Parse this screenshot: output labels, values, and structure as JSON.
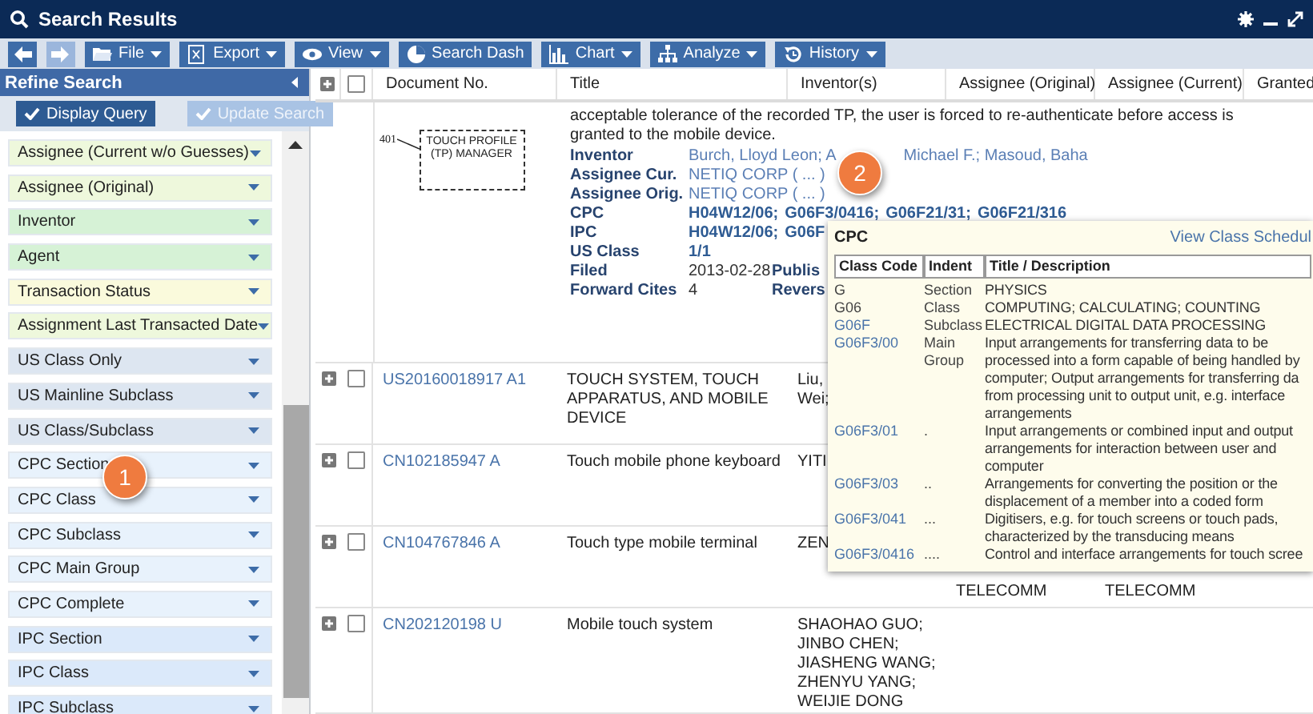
{
  "window": {
    "title": "Search Results"
  },
  "toolbar": [
    {
      "kind": "nav",
      "disabled": false
    },
    {
      "kind": "nav",
      "disabled": true
    },
    {
      "kind": "button",
      "label": "File",
      "menu": true
    },
    {
      "kind": "button",
      "label": "Export",
      "menu": true
    },
    {
      "kind": "button",
      "label": "View",
      "menu": true
    },
    {
      "kind": "button",
      "label": "Search Dash",
      "menu": false
    },
    {
      "kind": "button",
      "label": "Chart",
      "menu": true
    },
    {
      "kind": "button",
      "label": "Analyze",
      "menu": true
    },
    {
      "kind": "button",
      "label": "History",
      "menu": true
    }
  ],
  "refine": {
    "title": "Refine Search",
    "actions": [
      {
        "label": "Display Query",
        "disabled": false
      },
      {
        "label": "Update Search",
        "disabled": true
      }
    ],
    "filters": [
      {
        "label": "Assignee (Current w/o Guesses)",
        "color": "#eef8dc"
      },
      {
        "label": "Assignee (Original)",
        "color": "#eef8dc"
      },
      {
        "label": "Inventor",
        "color": "#d6f2d6"
      },
      {
        "label": "Agent",
        "color": "#d6f2d6"
      },
      {
        "label": "Transaction Status",
        "color": "#fafadc"
      },
      {
        "label": "Assignment Last Transacted Date",
        "color": "#eef8dc"
      },
      {
        "label": "US Class Only",
        "color": "#dde6f1"
      },
      {
        "label": "US Mainline Subclass",
        "color": "#dde6f1"
      },
      {
        "label": "US Class/Subclass",
        "color": "#dde6f1"
      },
      {
        "label": "CPC Section",
        "color": "#e8f2fc"
      },
      {
        "label": "CPC Class",
        "color": "#e8f2fc"
      },
      {
        "label": "CPC Subclass",
        "color": "#e8f2fc"
      },
      {
        "label": "CPC Main Group",
        "color": "#e8f2fc"
      },
      {
        "label": "CPC Complete",
        "color": "#e8f2fc"
      },
      {
        "label": "IPC Section",
        "color": "#dbe9fa"
      },
      {
        "label": "IPC Class",
        "color": "#dbe9fa"
      },
      {
        "label": "IPC Subclass",
        "color": "#dbe9fa"
      }
    ]
  },
  "table": {
    "select_all": {
      "checked": false
    },
    "columns": [
      "Document No.",
      "Title",
      "Inventor(s)",
      "Assignee (Original)",
      "Assignee (Current)",
      "Granted"
    ],
    "detail": {
      "figure": {
        "ref": "401",
        "box": "TOUCH PROFILE (TP) MANAGER"
      },
      "abstract_lines": [
        "acceptable tolerance of the recorded TP, the user is forced to re-authenticate before access is",
        "granted to the mobile device."
      ],
      "fields": [
        {
          "label": "Inventor",
          "kind": "link",
          "values": [
            "Burch, Lloyd Leon; A",
            "Michael F.; Masoud, Baha"
          ]
        },
        {
          "label": "Assignee Cur.",
          "kind": "link",
          "values": [
            "NETIQ CORP ( ... )"
          ]
        },
        {
          "label": "Assignee Orig.",
          "kind": "link",
          "values": [
            "NETIQ CORP ( ... )"
          ]
        },
        {
          "label": "CPC",
          "kind": "code",
          "values": [
            "H04W12/06;",
            "G06F3/0416;",
            "G06F21/31;",
            "G06F21/316"
          ]
        },
        {
          "label": "IPC",
          "kind": "code",
          "values": [
            "H04W12/06;",
            "G06F"
          ]
        },
        {
          "label": "US Class",
          "kind": "code",
          "values": [
            "1/1"
          ]
        },
        {
          "label": "Filed",
          "kind": "text",
          "values": [
            "2013-02-28"
          ],
          "side_label": "Publis"
        },
        {
          "label": "Forward Cites",
          "kind": "text",
          "values": [
            "4"
          ],
          "side_label": "Revers"
        }
      ]
    },
    "rows": [
      {
        "checked": false,
        "doc": "US20160018917 A1",
        "title": "TOUCH SYSTEM, TOUCH APPARATUS, AND MOBILE DEVICE",
        "inventors": [
          "Liu,",
          "Wei;"
        ]
      },
      {
        "checked": false,
        "doc": "CN102185947 A",
        "title": "Touch mobile phone keyboard",
        "inventors": [
          "YITI"
        ]
      },
      {
        "checked": false,
        "doc": "CN104767846 A",
        "title": "Touch type mobile terminal",
        "inventors": [
          "ZEN"
        ],
        "assignee_original": "TELECOMM",
        "assignee_current": "TELECOMM"
      },
      {
        "checked": false,
        "doc": "CN202120198 U",
        "title": "Mobile touch system",
        "inventors": [
          "SHAOHAO GUO;",
          "JINBO CHEN;",
          "JIASHENG WANG;",
          "ZHENYU YANG;",
          "WEIJIE DONG"
        ]
      }
    ]
  },
  "popup": {
    "title": "CPC",
    "link": "View Class Schedul",
    "columns": [
      "Class Code",
      "Indent",
      "Title / Description"
    ],
    "rows": [
      {
        "code": "G",
        "kind": "text",
        "indent": "Section",
        "lines": [
          "PHYSICS"
        ]
      },
      {
        "code": "G06",
        "kind": "text",
        "indent": "Class",
        "lines": [
          "COMPUTING; CALCULATING; COUNTING"
        ]
      },
      {
        "code": "G06F",
        "kind": "link",
        "indent": "Subclass",
        "lines": [
          "ELECTRICAL DIGITAL DATA PROCESSING"
        ]
      },
      {
        "code": "G06F3/00",
        "kind": "link",
        "indent": "Main Group",
        "lines": [
          "Input arrangements for transferring data to be",
          "processed into a form capable of being handled by",
          "computer; Output arrangements for transferring da",
          "from processing unit to output unit, e.g. interface",
          "arrangements"
        ]
      },
      {
        "code": "G06F3/01",
        "kind": "link",
        "indent": ".",
        "lines": [
          "Input arrangements or combined input and output",
          "arrangements for interaction between user and",
          "computer"
        ]
      },
      {
        "code": "G06F3/03",
        "kind": "link",
        "indent": "..",
        "lines": [
          "Arrangements for converting the position or the",
          "displacement of a member into a coded form"
        ]
      },
      {
        "code": "G06F3/041",
        "kind": "link",
        "indent": "...",
        "lines": [
          "Digitisers, e.g. for touch screens or touch pads,",
          "characterized by the transducing means"
        ]
      },
      {
        "code": "G06F3/0416",
        "kind": "link",
        "indent": "....",
        "lines": [
          "Control and interface arrangements for touch scree"
        ]
      }
    ]
  },
  "markers": [
    {
      "label": "1"
    },
    {
      "label": "2"
    }
  ]
}
